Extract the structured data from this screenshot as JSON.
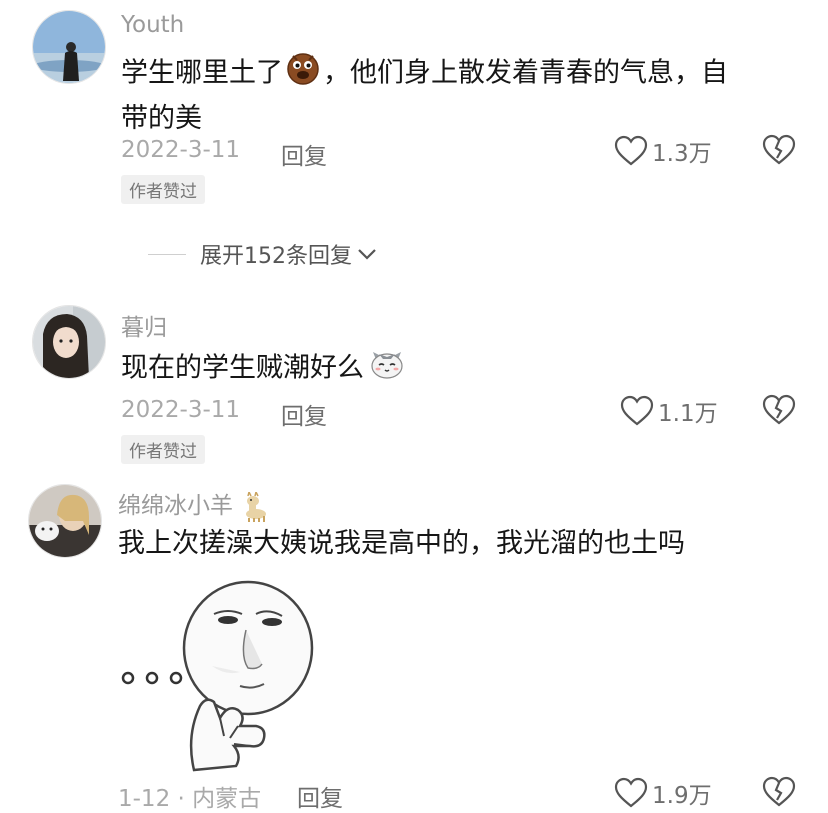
{
  "comments": [
    {
      "username": "Youth",
      "text_line1": "学生哪里土了",
      "text_line1_after": "，他们身上散发着青春的气息，自",
      "text_line2": "带的美",
      "date": "2022-3-11",
      "reply_label": "回复",
      "likes": "1.3万",
      "badge": "作者赞过",
      "emoji": "cookie-face-emoji"
    },
    {
      "username": "暮归",
      "text": "现在的学生贼潮好么",
      "date": "2022-3-11",
      "reply_label": "回复",
      "likes": "1.1万",
      "badge": "作者赞过",
      "emoji": "cat-face-emoji"
    },
    {
      "username": "绵绵冰小羊",
      "username_emoji": "alpaca-emoji",
      "text": "我上次搓澡大姨说我是高中的，我光溜的也土吗",
      "sticker": "thinking-meme-face-sticker",
      "date": "1-12",
      "location": "内蒙古",
      "reply_label": "回复",
      "likes": "1.9万"
    }
  ],
  "expand_replies": "展开152条回复",
  "colors": {
    "username": "#9a9a9a",
    "text": "#161616",
    "meta": "#a9a9a9",
    "badge_bg": "#f0f0f0"
  }
}
